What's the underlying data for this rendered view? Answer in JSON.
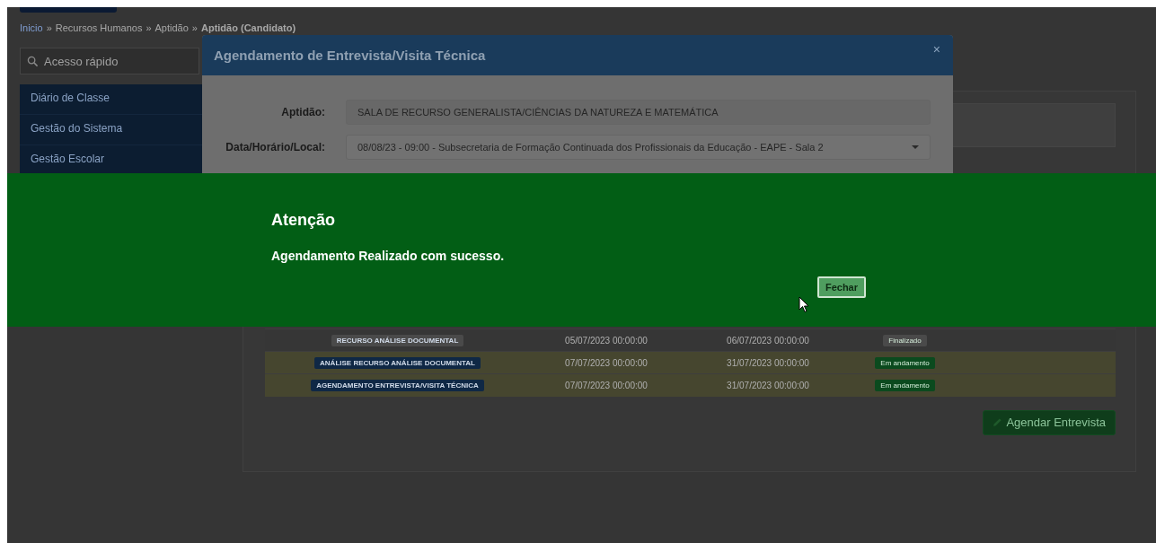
{
  "breadcrumb": {
    "separator": "»",
    "items": [
      {
        "label": "Inicio",
        "link": true
      },
      {
        "label": "Recursos Humanos",
        "link": false
      },
      {
        "label": "Aptidão",
        "link": false
      },
      {
        "label": "Aptidão (Candidato)",
        "link": false,
        "current": true
      }
    ]
  },
  "sidebar": {
    "search": {
      "placeholder": "Acesso rápido"
    },
    "items": [
      {
        "label": "Diário de Classe"
      },
      {
        "label": "Gestão do Sistema"
      },
      {
        "label": "Gestão Escolar"
      }
    ]
  },
  "table": {
    "rows": [
      {
        "stage": {
          "label": "RECURSO ANÁLISE DOCUMENTAL",
          "color": "#4a4a4a"
        },
        "start": "05/07/2023 00:00:00",
        "end": "06/07/2023 00:00:00",
        "status": {
          "label": "Finalizado",
          "color": "#4a4a4a"
        },
        "highlighted": false
      },
      {
        "stage": {
          "label": "ANÁLISE RECURSO ANÁLISE DOCUMENTAL",
          "color": "#0f2845"
        },
        "start": "07/07/2023 00:00:00",
        "end": "31/07/2023 00:00:00",
        "status": {
          "label": "Em andamento",
          "color": "#0b4a1e"
        },
        "highlighted": true
      },
      {
        "stage": {
          "label": "AGENDAMENTO ENTREVISTA/VISITA TÉCNICA",
          "color": "#0f2845"
        },
        "start": "07/07/2023 00:00:00",
        "end": "31/07/2023 00:00:00",
        "status": {
          "label": "Em andamento",
          "color": "#0b4a1e"
        },
        "highlighted": true
      }
    ]
  },
  "schedule_button": {
    "label": "Agendar Entrevista"
  },
  "modal": {
    "title": "Agendamento de Entrevista/Visita Técnica",
    "close": "×",
    "fields": [
      {
        "kind": "text",
        "label": "Aptidão:",
        "value": "SALA DE RECURSO GENERALISTA/CIÊNCIAS DA NATUREZA E MATEMÁTICA"
      },
      {
        "kind": "select",
        "label": "Data/Horário/Local:",
        "value": "08/08/23 - 09:00 - Subsecretaria de Formação Continuada dos Profissionais da Educação - EAPE - Sala 2"
      }
    ]
  },
  "alert": {
    "title": "Atenção",
    "message": "Agendamento Realizado com sucesso.",
    "button": "Fechar"
  }
}
